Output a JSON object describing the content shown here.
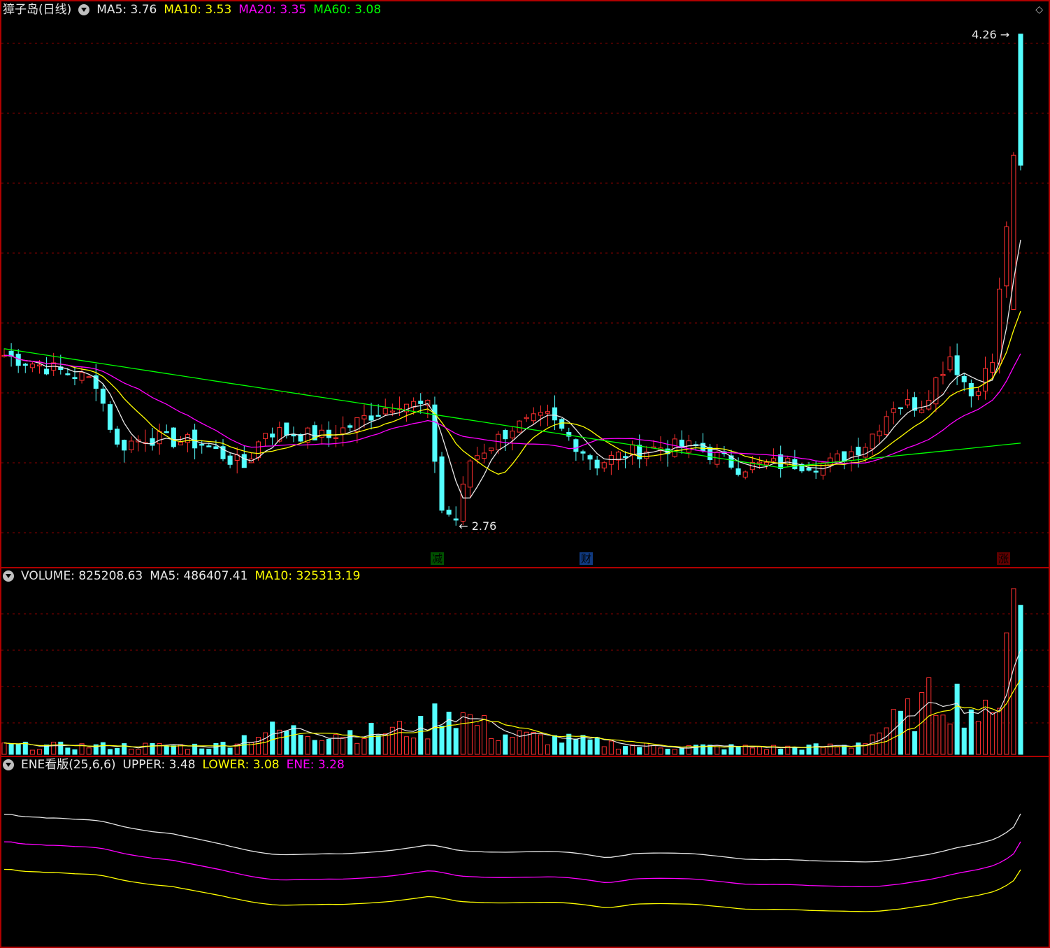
{
  "app": {
    "title": "獐子岛(日线)",
    "icons": [
      "collapse-circle-icon",
      "diamond-icon",
      "up-arrow-icon"
    ]
  },
  "price_panel": {
    "legend": [
      {
        "label": "MA5: 3.76",
        "color": "#e8e8e8"
      },
      {
        "label": "MA10: 3.53",
        "color": "#ffff00"
      },
      {
        "label": "MA20: 3.35",
        "color": "#ff00ff"
      },
      {
        "label": "MA60: 3.08",
        "color": "#00ff00"
      }
    ],
    "high_label": "4.26",
    "low_label": "2.76",
    "markers": [
      {
        "text": "减",
        "color": "#00c800"
      },
      {
        "text": "财",
        "color": "#2a6fd6"
      },
      {
        "text": "涨",
        "color": "#d02020"
      }
    ]
  },
  "volume_panel": {
    "legend": [
      {
        "label": "VOLUME: 825208.63",
        "color": "#e8e8e8"
      },
      {
        "label": "MA5: 486407.41",
        "color": "#e8e8e8"
      },
      {
        "label": "MA10: 325313.19",
        "color": "#ffff00"
      }
    ]
  },
  "ene_panel": {
    "legend": [
      {
        "label": "ENE看版(25,6,6)",
        "color": "#e8e8e8"
      },
      {
        "label": "UPPER: 3.48",
        "color": "#e8e8e8"
      },
      {
        "label": "LOWER: 3.08",
        "color": "#ffff00"
      },
      {
        "label": "ENE: 3.28",
        "color": "#ff00ff"
      }
    ]
  },
  "colors": {
    "up": "#ff3030",
    "down": "#54ffff",
    "ma5": "#e8e8e8",
    "ma10": "#ffff00",
    "ma20": "#ff00ff",
    "ma60": "#00ff00",
    "grid": "#8b0000",
    "border": "#b00000"
  },
  "chart_data": [
    {
      "type": "candlestick",
      "title": "獐子岛(日线)",
      "ylim": [
        2.7,
        4.3
      ],
      "anchors": [
        {
          "i": 0,
          "c": 3.28
        },
        {
          "i": 10,
          "c": 3.22
        },
        {
          "i": 13,
          "c": 3.2
        },
        {
          "i": 16,
          "c": 3.0
        },
        {
          "i": 20,
          "c": 3.03
        },
        {
          "i": 28,
          "c": 3.01
        },
        {
          "i": 34,
          "c": 2.94
        },
        {
          "i": 37,
          "c": 3.05
        },
        {
          "i": 46,
          "c": 3.03
        },
        {
          "i": 52,
          "c": 3.1
        },
        {
          "i": 56,
          "c": 3.14
        },
        {
          "i": 60,
          "c": 3.12
        },
        {
          "i": 62,
          "c": 2.81
        },
        {
          "i": 64,
          "c": 2.78
        },
        {
          "i": 66,
          "c": 2.96
        },
        {
          "i": 72,
          "c": 3.06
        },
        {
          "i": 77,
          "c": 3.09
        },
        {
          "i": 84,
          "c": 2.95
        },
        {
          "i": 88,
          "c": 2.98
        },
        {
          "i": 93,
          "c": 3.0
        },
        {
          "i": 98,
          "c": 3.0
        },
        {
          "i": 104,
          "c": 2.94
        },
        {
          "i": 112,
          "c": 2.95
        },
        {
          "i": 117,
          "c": 2.95
        },
        {
          "i": 122,
          "c": 3.01
        },
        {
          "i": 126,
          "c": 3.13
        },
        {
          "i": 130,
          "c": 3.13
        },
        {
          "i": 134,
          "c": 3.28
        },
        {
          "i": 137,
          "c": 3.16
        },
        {
          "i": 140,
          "c": 3.26
        },
        {
          "i": 143,
          "c": 3.89
        },
        {
          "i": 144,
          "c": 4.26
        }
      ],
      "extremes": {
        "high": 4.26,
        "low": 2.76
      }
    },
    {
      "type": "bar",
      "title": "VOLUME",
      "anchors": [
        {
          "i": 0,
          "v": 0.05
        },
        {
          "i": 30,
          "v": 0.05
        },
        {
          "i": 37,
          "v": 0.14
        },
        {
          "i": 52,
          "v": 0.13
        },
        {
          "i": 60,
          "v": 0.16
        },
        {
          "i": 62,
          "v": 0.3
        },
        {
          "i": 70,
          "v": 0.12
        },
        {
          "i": 90,
          "v": 0.05
        },
        {
          "i": 110,
          "v": 0.04
        },
        {
          "i": 120,
          "v": 0.05
        },
        {
          "i": 130,
          "v": 0.28
        },
        {
          "i": 133,
          "v": 0.38
        },
        {
          "i": 140,
          "v": 0.2
        },
        {
          "i": 143,
          "v": 1.0
        },
        {
          "i": 144,
          "v": 0.9
        }
      ]
    },
    {
      "type": "line",
      "title": "ENE看版(25,6,6)",
      "series": [
        {
          "name": "UPPER",
          "last": 3.48
        },
        {
          "name": "LOWER",
          "last": 3.08
        },
        {
          "name": "ENE",
          "last": 3.28
        }
      ]
    }
  ]
}
